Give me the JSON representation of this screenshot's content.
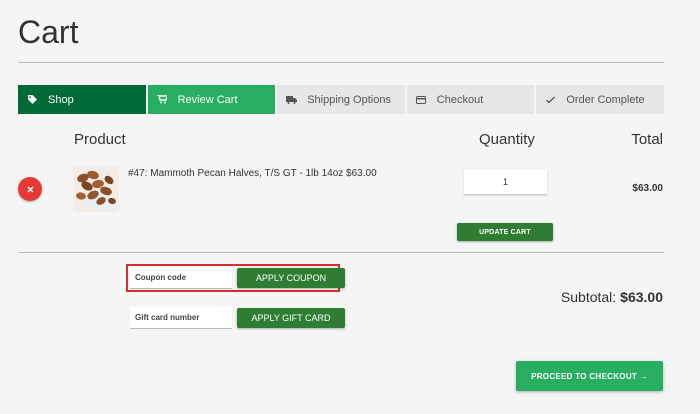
{
  "page": {
    "title": "Cart"
  },
  "steps": [
    {
      "label": "Shop",
      "icon": "tag-icon"
    },
    {
      "label": "Review Cart",
      "icon": "cart-icon"
    },
    {
      "label": "Shipping Options",
      "icon": "truck-icon"
    },
    {
      "label": "Checkout",
      "icon": "card-icon"
    },
    {
      "label": "Order Complete",
      "icon": "check-icon"
    }
  ],
  "table": {
    "headers": {
      "product": "Product",
      "quantity": "Quantity",
      "total": "Total"
    },
    "items": [
      {
        "name": "#47: Mammoth Pecan Halves, T/S GT - 1lb 14oz $63.00",
        "quantity": "1",
        "total": "$63.00"
      }
    ],
    "update_label": "UPDATE CART"
  },
  "coupon": {
    "placeholder": "Coupon code",
    "button": "APPLY COUPON"
  },
  "gift_card": {
    "placeholder": "Gift card number",
    "button": "APPLY GIFT CARD"
  },
  "subtotal": {
    "label": "Subtotal:",
    "amount": "$63.00"
  },
  "checkout": {
    "label": "PROCEED TO CHECKOUT →"
  },
  "colors": {
    "shop_step": "#006a37",
    "active_step": "#27ae60",
    "button_green": "#2e7d32",
    "remove_red": "#e53935",
    "highlight": "#d32f2f"
  }
}
